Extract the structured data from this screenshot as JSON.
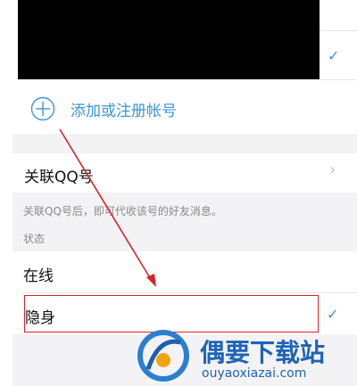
{
  "account": {
    "add_label": "添加或注册帐号",
    "selected_check": "✓"
  },
  "linked_qq": {
    "label": "关联QQ号",
    "description": "关联QQ号后，即可代收该号的好友消息。",
    "chevron": "›"
  },
  "status": {
    "section_label": "状态",
    "options": [
      {
        "label": "在线",
        "selected": false
      },
      {
        "label": "隐身",
        "selected": true
      }
    ],
    "check": "✓"
  },
  "watermark": {
    "brand": "偶要下载站",
    "url": "ouyaoxiazai.com"
  },
  "icons": [
    "plus-circle-icon",
    "checkmark-icon",
    "chevron-right-icon",
    "brand-logo-icon"
  ],
  "colors": {
    "accent": "#3a96d8",
    "annotation": "#d8232a"
  }
}
